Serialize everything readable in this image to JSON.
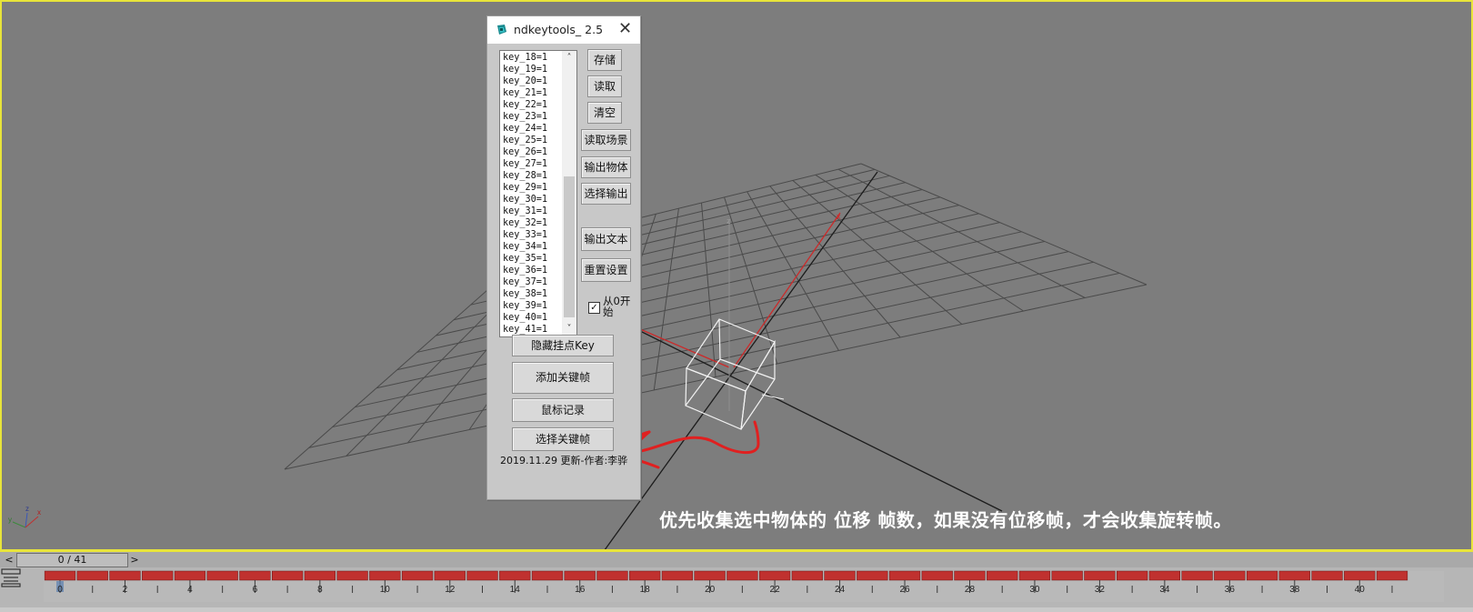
{
  "dialog": {
    "title": "ndkeytools_ 2.5",
    "list_items": [
      "key_18=1",
      "key_19=1",
      "key_20=1",
      "key_21=1",
      "key_22=1",
      "key_23=1",
      "key_24=1",
      "key_25=1",
      "key_26=1",
      "key_27=1",
      "key_28=1",
      "key_29=1",
      "key_30=1",
      "key_31=1",
      "key_32=1",
      "key_33=1",
      "key_34=1",
      "key_35=1",
      "key_36=1",
      "key_37=1",
      "key_38=1",
      "key_39=1",
      "key_40=1",
      "key_41=1"
    ],
    "buttons": {
      "save": "存储",
      "load": "读取",
      "clear": "清空",
      "read_scene": "读取场景",
      "export_object": "输出物体",
      "select_export": "选择输出",
      "export_text": "输出文本",
      "reset_settings": "重置设置",
      "hide_key": "隐藏挂点Key",
      "add_keyframe": "添加关键帧",
      "mouse_record": "鼠标记录",
      "select_keyframe": "选择关键帧"
    },
    "checkbox": {
      "label": "从0开始",
      "checked": true,
      "mark": "✓"
    },
    "footer": "2019.11.29 更新-作者:李骅"
  },
  "viewport": {
    "axis_labels": {
      "x": "x",
      "y": "y",
      "z": "z"
    },
    "caption": "优先收集选中物体的 位移 帧数，如果没有位移帧，才会收集旋转帧。"
  },
  "timeline": {
    "frame_display": "0 / 41",
    "prev_label": "<",
    "next_label": ">",
    "current_frame": 0,
    "total_frames": 41,
    "tick_labels": [
      "0",
      "2",
      "4",
      "6",
      "8",
      "10",
      "12",
      "14",
      "16",
      "18",
      "20",
      "22",
      "24",
      "26",
      "28",
      "30",
      "32",
      "34",
      "36",
      "38",
      "40"
    ]
  },
  "colors": {
    "viewport_border": "#e8e43a",
    "key_color": "#c0312f",
    "annotation": "#e02020",
    "grid": "#4a4a4a",
    "caption": "#ffffff"
  },
  "icons": {
    "app": "3dsmax-app-icon",
    "close": "close-icon",
    "track": "track-view-icon"
  }
}
